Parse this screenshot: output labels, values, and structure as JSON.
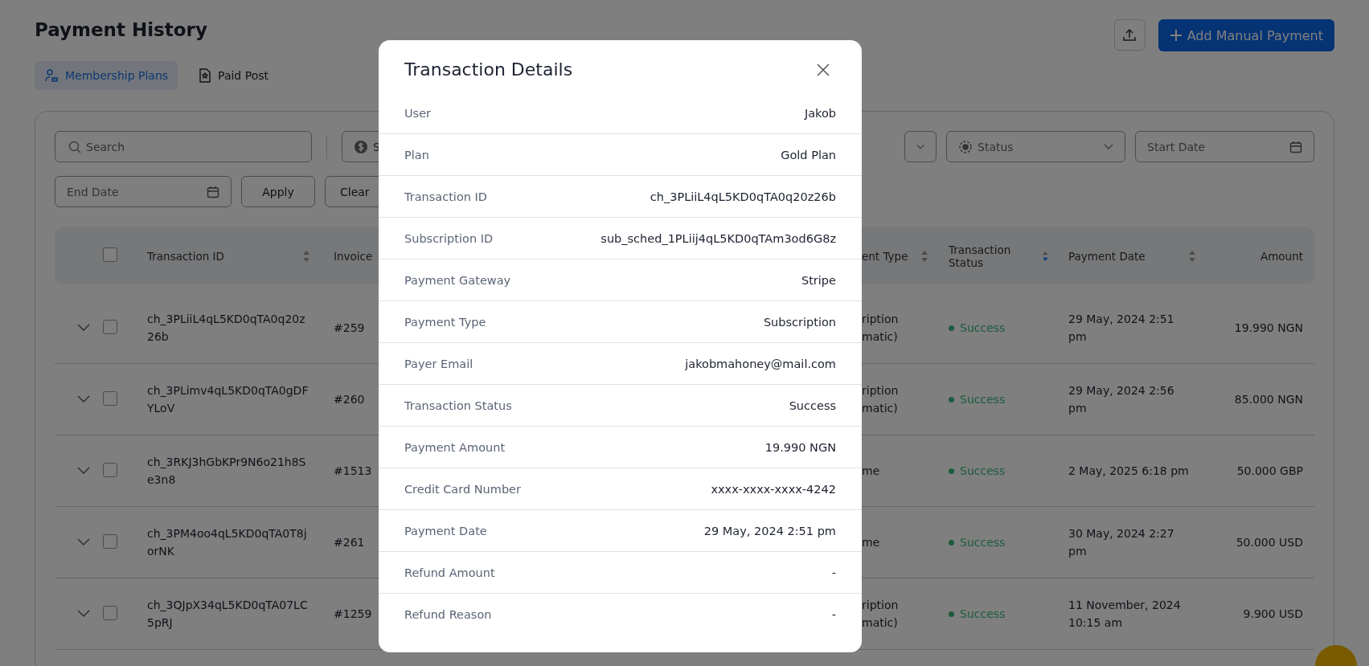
{
  "page_title": "Payment History",
  "add_button": "Add Manual Payment",
  "tabs": [
    {
      "label": "Membership Plans",
      "selected": true
    },
    {
      "label": "Paid Post",
      "selected": false
    }
  ],
  "filters": {
    "search_placeholder": "Search",
    "dropdown_1": "S",
    "status_placeholder": "Status",
    "start_date_placeholder": "Start Date",
    "end_date_placeholder": "End Date",
    "apply": "Apply",
    "clear": "Clear"
  },
  "table": {
    "select_all_checked": false,
    "columns": [
      {
        "label": "Transaction ID",
        "sortable": true,
        "sorted_descending": false
      },
      {
        "label": "Invoice"
      },
      {
        "label": "ent Type",
        "sortable": true,
        "sorted_descending": false
      },
      {
        "label": "Transaction Status",
        "sortable": true,
        "sorted_descending": true
      },
      {
        "label": "Payment Date",
        "sortable": true,
        "sorted_descending": false
      },
      {
        "label": "Amount"
      }
    ],
    "rows": [
      {
        "expanded": false,
        "checked": false,
        "transaction_id": "ch_3PLiiL4qL5KD0qTA0q20z26b",
        "invoice": "#259",
        "payment_type": "ription matic)",
        "status": "Success",
        "payment_date": "29 May, 2024 2:51 pm",
        "amount": "19.990 NGN"
      },
      {
        "expanded": false,
        "checked": false,
        "transaction_id": "ch_3PLimv4qL5KD0qTA0gDFYLoV",
        "invoice": "#260",
        "payment_type": "ription matic)",
        "status": "Success",
        "payment_date": "29 May, 2024 2:56 pm",
        "amount": "85.000 NGN"
      },
      {
        "expanded": false,
        "checked": false,
        "transaction_id": "ch_3RKJ3hGbKPr9N6o21h8Se3n8",
        "invoice": "#1513",
        "payment_type": "me",
        "status": "Success",
        "payment_date": "2 May, 2025 6:18 pm",
        "amount": "50.000 GBP"
      },
      {
        "expanded": false,
        "checked": false,
        "transaction_id": "ch_3PM4oo4qL5KD0qTA0T8jorNK",
        "invoice": "#261",
        "payment_type": "me",
        "status": "Success",
        "payment_date": "30 May, 2024 2:27 pm",
        "amount": "50.000 USD"
      },
      {
        "expanded": false,
        "checked": false,
        "transaction_id": "ch_3QJpX34qL5KD0qTA07LC5pRJ",
        "invoice": "#1259",
        "payment_type": "ription matic)",
        "status": "Success",
        "payment_date": "11 November, 2024 10:15 am",
        "amount": "9.900 USD"
      }
    ]
  },
  "modal": {
    "title": "Transaction Details",
    "fields": [
      {
        "label": "User",
        "value": "Jakob"
      },
      {
        "label": "Plan",
        "value": "Gold Plan"
      },
      {
        "label": "Transaction ID",
        "value": "ch_3PLiiL4qL5KD0qTA0q20z26b"
      },
      {
        "label": "Subscription ID",
        "value": "sub_sched_1PLiij4qL5KD0qTAm3od6G8z"
      },
      {
        "label": "Payment Gateway",
        "value": "Stripe"
      },
      {
        "label": "Payment Type",
        "value": "Subscription"
      },
      {
        "label": "Payer Email",
        "value": "jakobmahoney@mail.com"
      },
      {
        "label": "Transaction Status",
        "value": "Success"
      },
      {
        "label": "Payment Amount",
        "value": "19.990 NGN"
      },
      {
        "label": "Credit Card Number",
        "value": "xxxx-xxxx-xxxx-4242"
      },
      {
        "label": "Payment Date",
        "value": "29 May, 2024 2:51 pm"
      },
      {
        "label": "Refund Amount",
        "value": "-"
      },
      {
        "label": "Refund Reason",
        "value": "-"
      }
    ]
  }
}
